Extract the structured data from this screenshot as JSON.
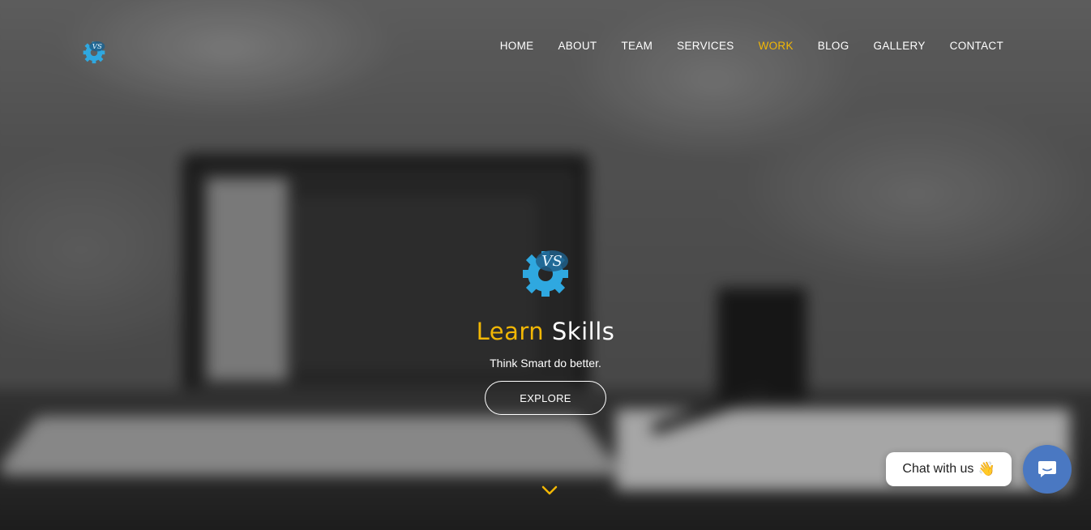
{
  "nav": {
    "items": [
      {
        "label": "HOME"
      },
      {
        "label": "ABOUT"
      },
      {
        "label": "TEAM"
      },
      {
        "label": "SERVICES"
      },
      {
        "label": "WORK",
        "active": true
      },
      {
        "label": "BLOG"
      },
      {
        "label": "GALLERY"
      },
      {
        "label": "CONTACT"
      }
    ]
  },
  "hero": {
    "headline_accent": "Learn",
    "headline_rest": "Skills",
    "tagline": "Think Smart do better.",
    "cta_label": "EXPLORE",
    "scroll_icon": "chevron-down-icon"
  },
  "logo": {
    "letters": "VS",
    "icon": "gear-logo-icon"
  },
  "chat": {
    "bubble_text": "Chat with us",
    "bubble_emoji": "👋",
    "button_icon": "chat-icon"
  },
  "colors": {
    "accent": "#f2b705",
    "chat_button": "#4a78c2",
    "logo_blue": "#2fa8e0"
  }
}
